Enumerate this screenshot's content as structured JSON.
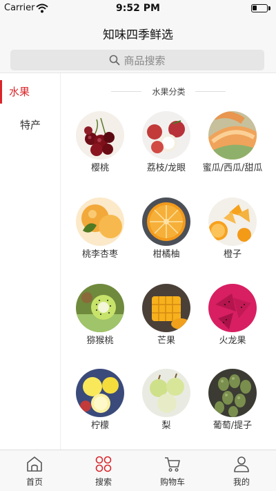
{
  "status_bar": {
    "carrier": "Carrier",
    "time": "9:52 PM",
    "battery_level": 0.3
  },
  "header": {
    "title": "知味四季鲜选"
  },
  "search": {
    "placeholder": "商品搜索"
  },
  "sidebar": {
    "items": [
      {
        "label": "水果",
        "active": true
      },
      {
        "label": "特产",
        "active": false
      }
    ]
  },
  "content": {
    "section_title": "水果分类",
    "categories": [
      {
        "label": "樱桃",
        "icon": "cherries-photo"
      },
      {
        "label": "荔枝/龙眼",
        "icon": "lychee-photo"
      },
      {
        "label": "蜜瓜/西瓜/甜瓜",
        "icon": "melon-photo"
      },
      {
        "label": "桃李杏枣",
        "icon": "peach-photo"
      },
      {
        "label": "柑橘柚",
        "icon": "tangerine-photo"
      },
      {
        "label": "橙子",
        "icon": "orange-photo"
      },
      {
        "label": "猕猴桃",
        "icon": "kiwi-photo"
      },
      {
        "label": "芒果",
        "icon": "mango-photo"
      },
      {
        "label": "火龙果",
        "icon": "dragonfruit-photo"
      },
      {
        "label": "柠檬",
        "icon": "lemon-photo"
      },
      {
        "label": "梨",
        "icon": "pear-photo"
      },
      {
        "label": "葡萄/提子",
        "icon": "grape-photo"
      }
    ]
  },
  "tab_bar": {
    "tabs": [
      {
        "label": "首页",
        "icon": "home-icon"
      },
      {
        "label": "搜索",
        "icon": "grid-circles-icon",
        "active": true
      },
      {
        "label": "购物车",
        "icon": "cart-icon"
      },
      {
        "label": "我的",
        "icon": "user-icon"
      }
    ]
  },
  "colors": {
    "accent": "#d9262b",
    "background": "#ffffff",
    "bar": "#f7f7f7"
  }
}
